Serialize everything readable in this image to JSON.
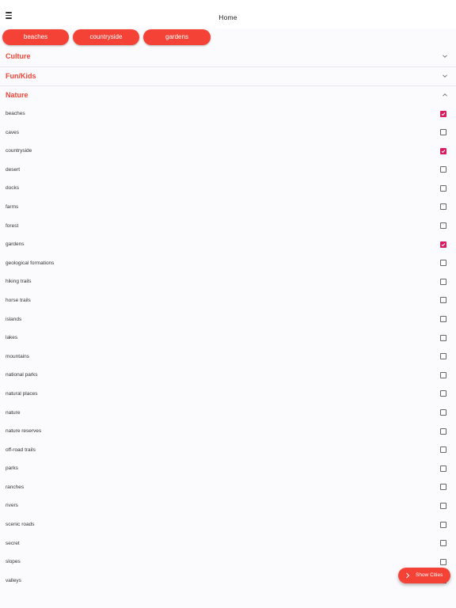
{
  "header": {
    "title": "Home",
    "menu_icon": "hamburger-menu-icon"
  },
  "selected_chips": [
    "beaches",
    "countryside",
    "gardens"
  ],
  "sections": [
    {
      "title": "Culture",
      "expanded": false
    },
    {
      "title": "Fun/Kids",
      "expanded": false
    },
    {
      "title": "Nature",
      "expanded": true
    }
  ],
  "nature_items": [
    {
      "label": "beaches",
      "checked": true
    },
    {
      "label": "caves",
      "checked": false
    },
    {
      "label": "countryside",
      "checked": true
    },
    {
      "label": "desert",
      "checked": false
    },
    {
      "label": "docks",
      "checked": false
    },
    {
      "label": "farms",
      "checked": false
    },
    {
      "label": "forest",
      "checked": false
    },
    {
      "label": "gardens",
      "checked": true
    },
    {
      "label": "geological formations",
      "checked": false
    },
    {
      "label": "hiking trails",
      "checked": false
    },
    {
      "label": "horse trails",
      "checked": false
    },
    {
      "label": "islands",
      "checked": false
    },
    {
      "label": "lakes",
      "checked": false
    },
    {
      "label": "mountains",
      "checked": false
    },
    {
      "label": "national parks",
      "checked": false
    },
    {
      "label": "natural places",
      "checked": false
    },
    {
      "label": "nature",
      "checked": false
    },
    {
      "label": "nature reserves",
      "checked": false
    },
    {
      "label": "off-road trails",
      "checked": false
    },
    {
      "label": "parks",
      "checked": false
    },
    {
      "label": "ranches",
      "checked": false
    },
    {
      "label": "rivers",
      "checked": false
    },
    {
      "label": "scenic roads",
      "checked": false
    },
    {
      "label": "secret",
      "checked": false
    },
    {
      "label": "slopes",
      "checked": false
    },
    {
      "label": "valleys",
      "checked": false
    }
  ],
  "fab": {
    "label": "Show Cities",
    "icon": "chevron-right-icon"
  },
  "colors": {
    "accent": "#f44336",
    "checkbox_checked": "#d81b60"
  }
}
